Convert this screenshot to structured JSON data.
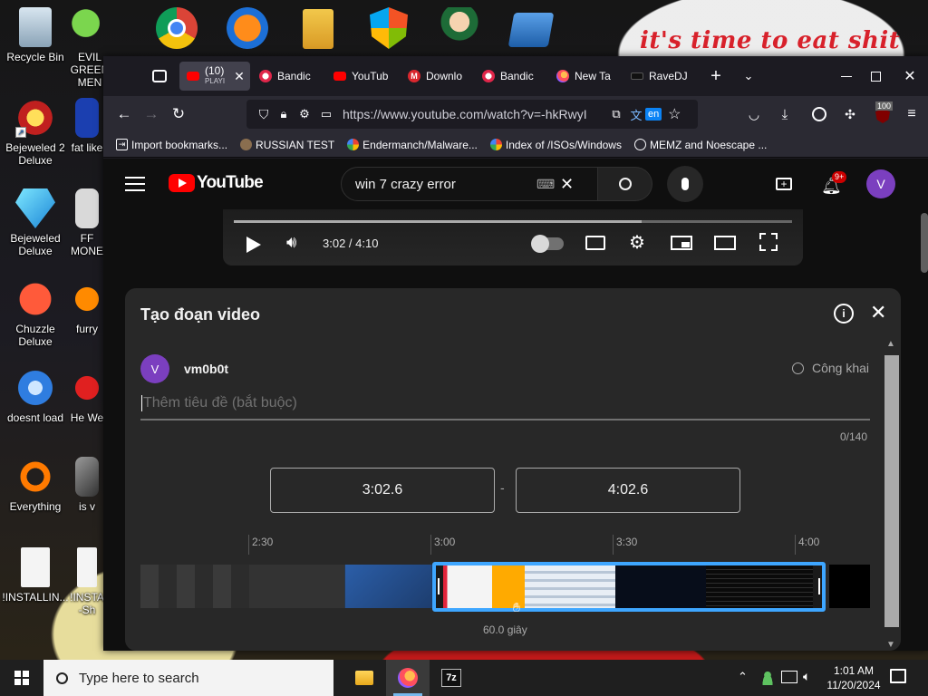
{
  "desktop": {
    "wallpaper_text": "it's time to eat shit",
    "icons": [
      {
        "label": "Recycle Bin",
        "icon": "recycle-bin-icon"
      },
      {
        "label": "Bejeweled 2 Deluxe",
        "icon": "bejeweled-2-icon"
      },
      {
        "label": "Bejeweled Deluxe",
        "icon": "bejeweled-icon"
      },
      {
        "label": "Chuzzle Deluxe",
        "icon": "chuzzle-icon"
      },
      {
        "label": "doesnt load",
        "icon": "thunderbird-icon"
      },
      {
        "label": "Everything",
        "icon": "everything-search-icon"
      },
      {
        "label": "!INSTALLIN...",
        "icon": "document-icon"
      },
      {
        "label": "EVIL GREEN MEN",
        "icon": "green-men-icon"
      },
      {
        "label": "fat like",
        "icon": "fat-like-icon"
      },
      {
        "label": "FF MONE",
        "icon": "ff-mone-icon"
      },
      {
        "label": "furry",
        "icon": "furry-icon"
      },
      {
        "label": "He We",
        "icon": "he-we-icon"
      },
      {
        "label": "is v",
        "icon": "is-v-icon"
      },
      {
        "label": "!INSTA -Sh",
        "icon": "document-shortcut-icon"
      }
    ]
  },
  "browser": {
    "tabs": [
      {
        "label": "(10)",
        "sublabel": "PLAYI",
        "favicon": "youtube-icon",
        "active": true
      },
      {
        "label": "Bandic",
        "favicon": "bandicam-icon"
      },
      {
        "label": "YouTub",
        "favicon": "youtube-icon"
      },
      {
        "label": "Downlo",
        "favicon": "mega-icon"
      },
      {
        "label": "Bandic",
        "favicon": "bandicam-icon"
      },
      {
        "label": "New Ta",
        "favicon": "firefox-icon"
      },
      {
        "label": "RaveDJ",
        "favicon": "ravedj-icon"
      }
    ],
    "new_tab": "+",
    "url": "https://www.youtube.com/watch?v=-hkRwyI",
    "translate_badge": "en",
    "extension_badge": "100",
    "bookmarks": [
      {
        "label": "Import bookmarks...",
        "icon": "import-icon"
      },
      {
        "label": "RUSSIAN TEST",
        "icon": "bookmark-icon"
      },
      {
        "label": "Endermanch/Malware...",
        "icon": "google-icon"
      },
      {
        "label": "Index of /ISOs/Windows",
        "icon": "google-icon"
      },
      {
        "label": "MEMZ and Noescape ...",
        "icon": "globe-icon"
      }
    ]
  },
  "youtube": {
    "logo": "YouTube",
    "search_value": "win 7 crazy error",
    "notifications": "9+",
    "avatar": "V",
    "player": {
      "time": "3:02 / 4:10"
    },
    "clip": {
      "title": "Tạo đoạn video",
      "channel_initial": "V",
      "channel_name": "vm0b0t",
      "visibility": "Công khai",
      "title_placeholder": "Thêm tiêu đề (bắt buộc)",
      "char_count": "0/140",
      "start": "3:02.6",
      "end": "4:02.6",
      "dash": "-",
      "ticks": [
        "2:30",
        "3:00",
        "3:30",
        "4:00"
      ],
      "duration": "60.0 giây"
    }
  },
  "taskbar": {
    "search_placeholder": "Type here to search",
    "time": "1:01 AM",
    "date": "11/20/2024",
    "apps": [
      {
        "icon": "file-explorer-icon"
      },
      {
        "icon": "firefox-icon",
        "active": true
      },
      {
        "icon": "7zip-icon",
        "label": "7z"
      }
    ]
  },
  "colors": {
    "youtube_red": "#ff0000",
    "clip_blue": "#3ea6ff",
    "avatar_purple": "#7b3fbf",
    "firefox_toolbar": "#2b2a33"
  }
}
